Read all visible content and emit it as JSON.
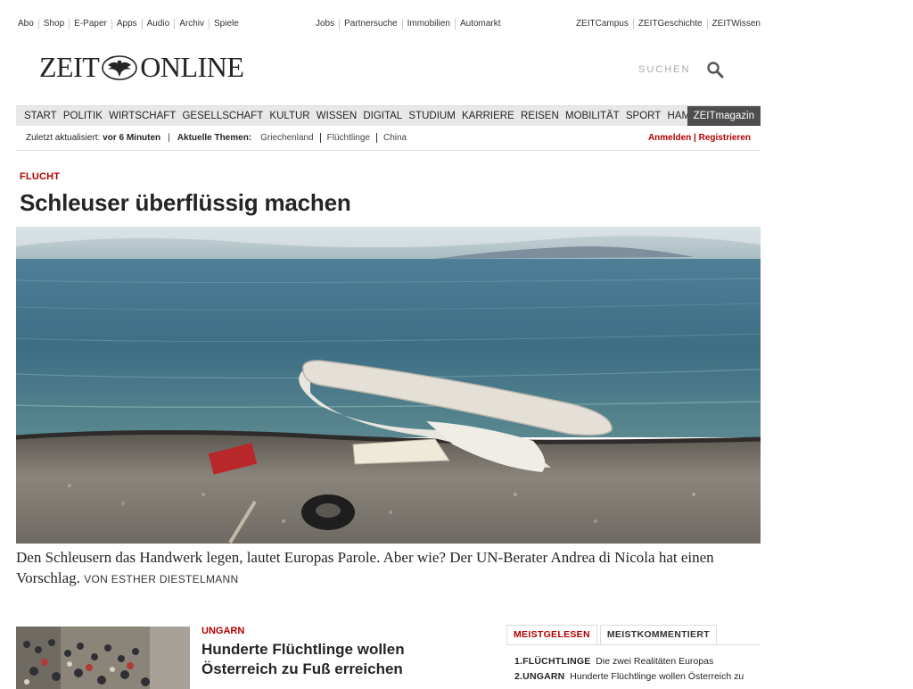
{
  "service_bar": {
    "left": [
      "Abo",
      "Shop",
      "E-Paper",
      "Apps",
      "Audio",
      "Archiv",
      "Spiele"
    ],
    "middle": [
      "Jobs",
      "Partnersuche",
      "Immobilien",
      "Automarkt"
    ],
    "right": [
      "ZEITCampus",
      "ZEITGeschichte",
      "ZEITWissen"
    ]
  },
  "logo": {
    "left": "ZEIT",
    "right": "ONLINE"
  },
  "search": {
    "label": "SUCHEN"
  },
  "nav": {
    "items": [
      "START",
      "POLITIK",
      "WIRTSCHAFT",
      "GESELLSCHAFT",
      "KULTUR",
      "WISSEN",
      "DIGITAL",
      "STUDIUM",
      "KARRIERE",
      "REISEN",
      "MOBILITÄT",
      "SPORT",
      "HAMBURG"
    ],
    "zeitmagazin": "ZEITmagazin"
  },
  "subbar": {
    "updated_label": "Zuletzt aktualisiert:",
    "updated_value": "vor 6 Minuten",
    "separator": "|",
    "topics_label": "Aktuelle Themen:",
    "topics": [
      "Griechenland",
      "Flüchtlinge",
      "China"
    ],
    "login": "Anmelden",
    "register": "Registrieren",
    "login_sep": " | "
  },
  "lead": {
    "kicker": "FLUCHT",
    "headline": "Schleuser überflüssig machen",
    "teaser": "Den Schleusern das Handwerk legen, lautet Europas Parole. Aber wie? Der UN-Berater Andrea di Nicola hat einen Vorschlag.",
    "author": "VON ESTHER DIESTELMANN"
  },
  "second": {
    "kicker": "UNGARN",
    "headline": "Hunderte Flüchtlinge wollen Österreich zu Fuß erreichen"
  },
  "most": {
    "tabs": [
      "MEISTGELESEN",
      "MEISTKOMMENTIERT"
    ],
    "items": [
      {
        "num": "1.",
        "kicker": "FLÜCHTLINGE",
        "title": "Die zwei Realitäten Europas"
      },
      {
        "num": "2.",
        "kicker": "UNGARN",
        "title": "Hunderte Flüchtlinge wollen Österreich zu"
      }
    ]
  },
  "colors": {
    "accent": "#b10000",
    "nav_bg": "#e8e8e8",
    "zeitmagazin_bg": "#4d4d4d"
  }
}
